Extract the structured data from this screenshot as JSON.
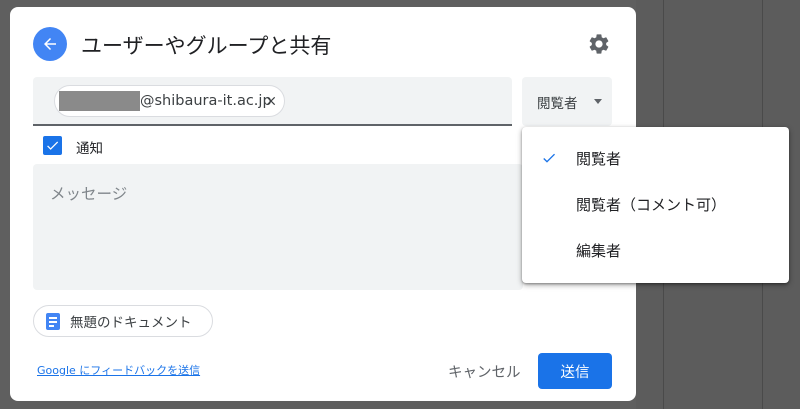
{
  "dialog": {
    "title": "ユーザーやグループと共有",
    "recipient": {
      "email_visible": "@shibaura-it.ac.jp"
    },
    "role_button": {
      "label": "閲覧者"
    },
    "notify": {
      "label": "通知",
      "checked": true
    },
    "message": {
      "placeholder": "メッセージ"
    },
    "attachment": {
      "label": "無題のドキュメント"
    },
    "footer": {
      "feedback_link": "Google にフィードバックを送信",
      "cancel_label": "キャンセル",
      "send_label": "送信"
    }
  },
  "role_menu": {
    "items": [
      {
        "label": "閲覧者",
        "selected": true
      },
      {
        "label": "閲覧者（コメント可）",
        "selected": false
      },
      {
        "label": "編集者",
        "selected": false
      }
    ]
  },
  "colors": {
    "accent": "#1a73e8",
    "back_button": "#4285f4",
    "field_bg": "#f1f3f4"
  }
}
